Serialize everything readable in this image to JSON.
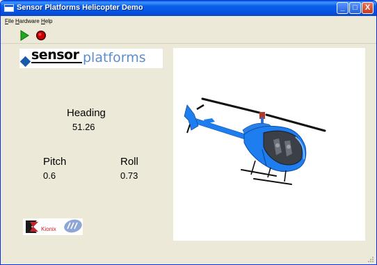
{
  "window": {
    "title": "Sensor Platforms Helicopter Demo",
    "controls": {
      "minimize": "_",
      "maximize": "□",
      "close": "X"
    }
  },
  "menu": {
    "file": "File",
    "hardware": "Hardware",
    "help": "Help"
  },
  "toolbar": {
    "play_icon": "play-icon",
    "stop_icon": "record-stop-icon"
  },
  "logo": {
    "part1": "sensor",
    "part2": "platforms"
  },
  "readouts": {
    "heading": {
      "label": "Heading",
      "value": "51.26"
    },
    "pitch": {
      "label": "Pitch",
      "value": "0.6"
    },
    "roll": {
      "label": "Roll",
      "value": "0.73"
    }
  },
  "partner": {
    "kionix": "Kionix"
  },
  "colors": {
    "titlebar": "#0554e3",
    "background": "#ece9d8",
    "helicopter_body": "#1e7ef0",
    "logo_blue": "#5b8ec9",
    "play_green": "#1ea81e",
    "stop_red": "#cc0000"
  }
}
